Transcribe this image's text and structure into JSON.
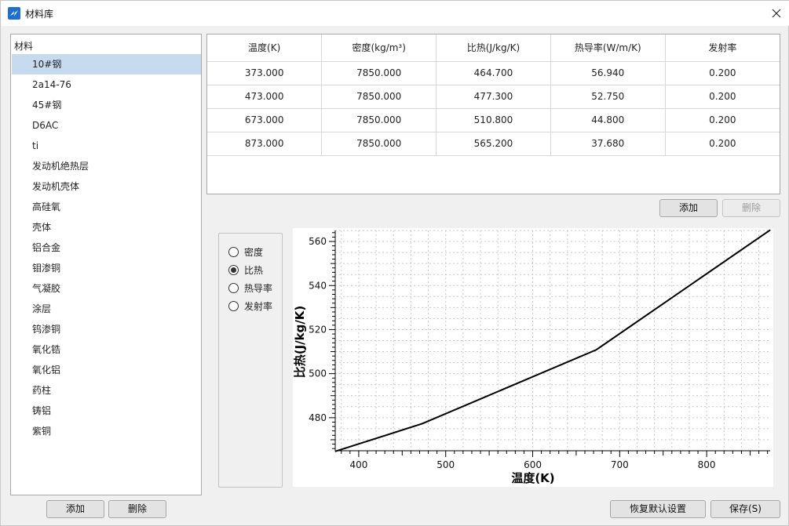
{
  "window": {
    "title": "材料库",
    "close_icon": "close-icon",
    "app_icon": "app-logo-icon"
  },
  "materials": {
    "header": "材料",
    "selected_index": 0,
    "items": [
      "10#钢",
      "2a14-76",
      "45#钢",
      "D6AC",
      "ti",
      "发动机绝热层",
      "发动机壳体",
      "高硅氧",
      "壳体",
      "铝合金",
      "钼渗铜",
      "气凝胶",
      "涂层",
      "钨渗铜",
      "氧化锆",
      "氧化铝",
      "药柱",
      "铸铝",
      "紫铜"
    ],
    "add_label": "添加",
    "delete_label": "删除"
  },
  "table": {
    "headers": [
      "温度(K)",
      "密度(kg/m³)",
      "比热(J/kg/K)",
      "热导率(W/m/K)",
      "发射率"
    ],
    "rows": [
      [
        "373.000",
        "7850.000",
        "464.700",
        "56.940",
        "0.200"
      ],
      [
        "473.000",
        "7850.000",
        "477.300",
        "52.750",
        "0.200"
      ],
      [
        "673.000",
        "7850.000",
        "510.800",
        "44.800",
        "0.200"
      ],
      [
        "873.000",
        "7850.000",
        "565.200",
        "37.680",
        "0.200"
      ]
    ],
    "add_label": "添加",
    "delete_label": "删除"
  },
  "property_options": {
    "items": [
      "密度",
      "比热",
      "热导率",
      "发射率"
    ],
    "selected": "比热"
  },
  "chart_data": {
    "type": "line",
    "xlabel": "温度(K)",
    "ylabel": "比热(J/kg/K)",
    "xlim": [
      373,
      873
    ],
    "ylim": [
      465,
      565
    ],
    "xticks": [
      400,
      500,
      600,
      700,
      800
    ],
    "yticks": [
      480,
      500,
      520,
      540,
      560
    ],
    "grid": true,
    "x": [
      373,
      473,
      673,
      873
    ],
    "series": [
      {
        "values": [
          464.7,
          477.3,
          510.8,
          565.2
        ]
      }
    ]
  },
  "footer": {
    "restore_label": "恢复默认设置",
    "save_label": "保存(S)"
  }
}
